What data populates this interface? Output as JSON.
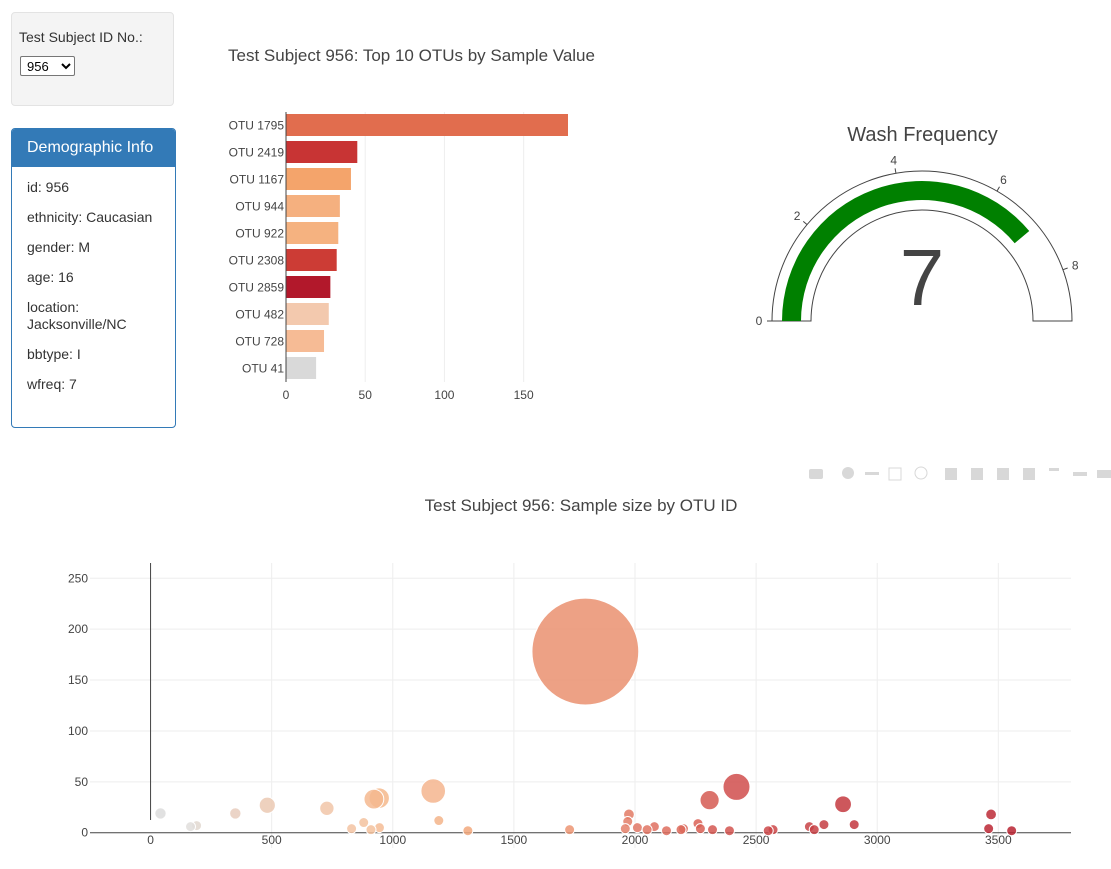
{
  "selector": {
    "label": "Test Subject ID No.:",
    "value": "956",
    "options": [
      "956"
    ]
  },
  "demographic": {
    "heading": "Demographic Info",
    "rows": [
      "id: 956",
      "ethnicity: Caucasian",
      "gender: M",
      "age: 16",
      "location: Jacksonville/NC",
      "bbtype: I",
      "wfreq: 7"
    ]
  },
  "chart_data": [
    {
      "type": "bar",
      "orientation": "horizontal",
      "title": "Test Subject 956: Top 10 OTUs by Sample Value",
      "categories": [
        "OTU 1795",
        "OTU 2419",
        "OTU 1167",
        "OTU 944",
        "OTU 922",
        "OTU 2308",
        "OTU 2859",
        "OTU 482",
        "OTU 728",
        "OTU 41"
      ],
      "values": [
        178,
        45,
        41,
        34,
        33,
        32,
        28,
        27,
        24,
        19
      ],
      "colors": [
        "#e16d4e",
        "#c83434",
        "#f4a46b",
        "#f5b07f",
        "#f5b280",
        "#cc3c35",
        "#b2182b",
        "#f3c9ae",
        "#f6bb95",
        "#d9d9d9"
      ],
      "xlim": [
        0,
        178
      ],
      "xticks": [
        0,
        50,
        100,
        150
      ]
    },
    {
      "type": "gauge",
      "title": "Wash Frequency",
      "value": 7,
      "range": [
        0,
        9
      ],
      "ticks": [
        0,
        2,
        4,
        6,
        8
      ],
      "bar_color": "#008000"
    },
    {
      "type": "scatter",
      "title": "Test Subject 956: Sample size by OTU ID",
      "xlim": [
        -250,
        3800
      ],
      "ylim": [
        -15,
        265
      ],
      "xticks": [
        0,
        500,
        1000,
        1500,
        2000,
        2500,
        3000,
        3500
      ],
      "yticks": [
        0,
        50,
        100,
        150,
        200,
        250
      ],
      "points": [
        {
          "x": 41,
          "y": 19,
          "color": "#dcdcdc"
        },
        {
          "x": 165,
          "y": 6,
          "color": "#e0dedc"
        },
        {
          "x": 190,
          "y": 7,
          "color": "#e2d8d0"
        },
        {
          "x": 350,
          "y": 19,
          "color": "#e7cdbd"
        },
        {
          "x": 482,
          "y": 27,
          "color": "#ebc9b3"
        },
        {
          "x": 728,
          "y": 24,
          "color": "#f1c6a8"
        },
        {
          "x": 830,
          "y": 4,
          "color": "#f3c3a2"
        },
        {
          "x": 880,
          "y": 10,
          "color": "#f3c29f"
        },
        {
          "x": 910,
          "y": 3,
          "color": "#f3c19c"
        },
        {
          "x": 922,
          "y": 33,
          "color": "#f4b98f"
        },
        {
          "x": 944,
          "y": 34,
          "color": "#f5b88c"
        },
        {
          "x": 945,
          "y": 5,
          "color": "#f4bc95"
        },
        {
          "x": 1167,
          "y": 41,
          "color": "#f4b58e"
        },
        {
          "x": 1190,
          "y": 12,
          "color": "#f3b48a"
        },
        {
          "x": 1310,
          "y": 2,
          "color": "#f2a87c"
        },
        {
          "x": 1730,
          "y": 3,
          "color": "#ec9573"
        },
        {
          "x": 1795,
          "y": 178,
          "color": "#ea9170"
        },
        {
          "x": 1960,
          "y": 4,
          "color": "#e4806a"
        },
        {
          "x": 1970,
          "y": 11,
          "color": "#e37d66"
        },
        {
          "x": 1975,
          "y": 18,
          "color": "#e27a64"
        },
        {
          "x": 2010,
          "y": 5,
          "color": "#e17765"
        },
        {
          "x": 2050,
          "y": 3,
          "color": "#e07463"
        },
        {
          "x": 2080,
          "y": 6,
          "color": "#df7060"
        },
        {
          "x": 2130,
          "y": 2,
          "color": "#de6d5e"
        },
        {
          "x": 2190,
          "y": 3,
          "color": "#dc6a5b"
        },
        {
          "x": 2200,
          "y": 4,
          "color": "#db6559"
        },
        {
          "x": 2260,
          "y": 9,
          "color": "#da6256"
        },
        {
          "x": 2270,
          "y": 4,
          "color": "#d85f54"
        },
        {
          "x": 2308,
          "y": 32,
          "color": "#d55a52"
        },
        {
          "x": 2320,
          "y": 3,
          "color": "#d45751"
        },
        {
          "x": 2390,
          "y": 2,
          "color": "#d2534f"
        },
        {
          "x": 2419,
          "y": 45,
          "color": "#d04e4c"
        },
        {
          "x": 2550,
          "y": 2,
          "color": "#cd494a"
        },
        {
          "x": 2570,
          "y": 3,
          "color": "#cc4648"
        },
        {
          "x": 2720,
          "y": 6,
          "color": "#c84346"
        },
        {
          "x": 2740,
          "y": 3,
          "color": "#c74044"
        },
        {
          "x": 2780,
          "y": 8,
          "color": "#c63e43"
        },
        {
          "x": 2859,
          "y": 28,
          "color": "#c43a40"
        },
        {
          "x": 2905,
          "y": 8,
          "color": "#c3373e"
        },
        {
          "x": 3470,
          "y": 18,
          "color": "#bc2a36"
        },
        {
          "x": 3460,
          "y": 4,
          "color": "#bb2734"
        },
        {
          "x": 3555,
          "y": 2,
          "color": "#b82331"
        }
      ]
    }
  ]
}
